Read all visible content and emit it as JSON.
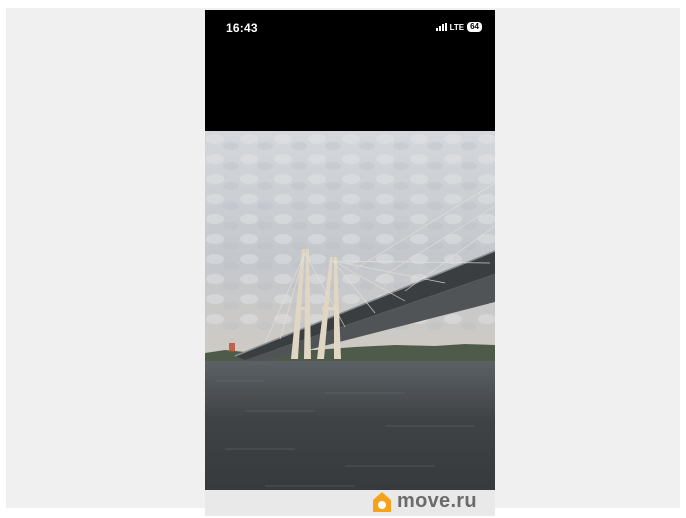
{
  "status_bar": {
    "time": "16:43",
    "network": "LTE",
    "battery": "64"
  },
  "photo": {
    "subject": "cable-stayed bridge over river",
    "sky_color": "#c9cdd2",
    "water_color": "#45494b"
  },
  "watermark": {
    "text": "move.ru",
    "icon": "house-logo-icon",
    "accent": "#f7a21b"
  }
}
